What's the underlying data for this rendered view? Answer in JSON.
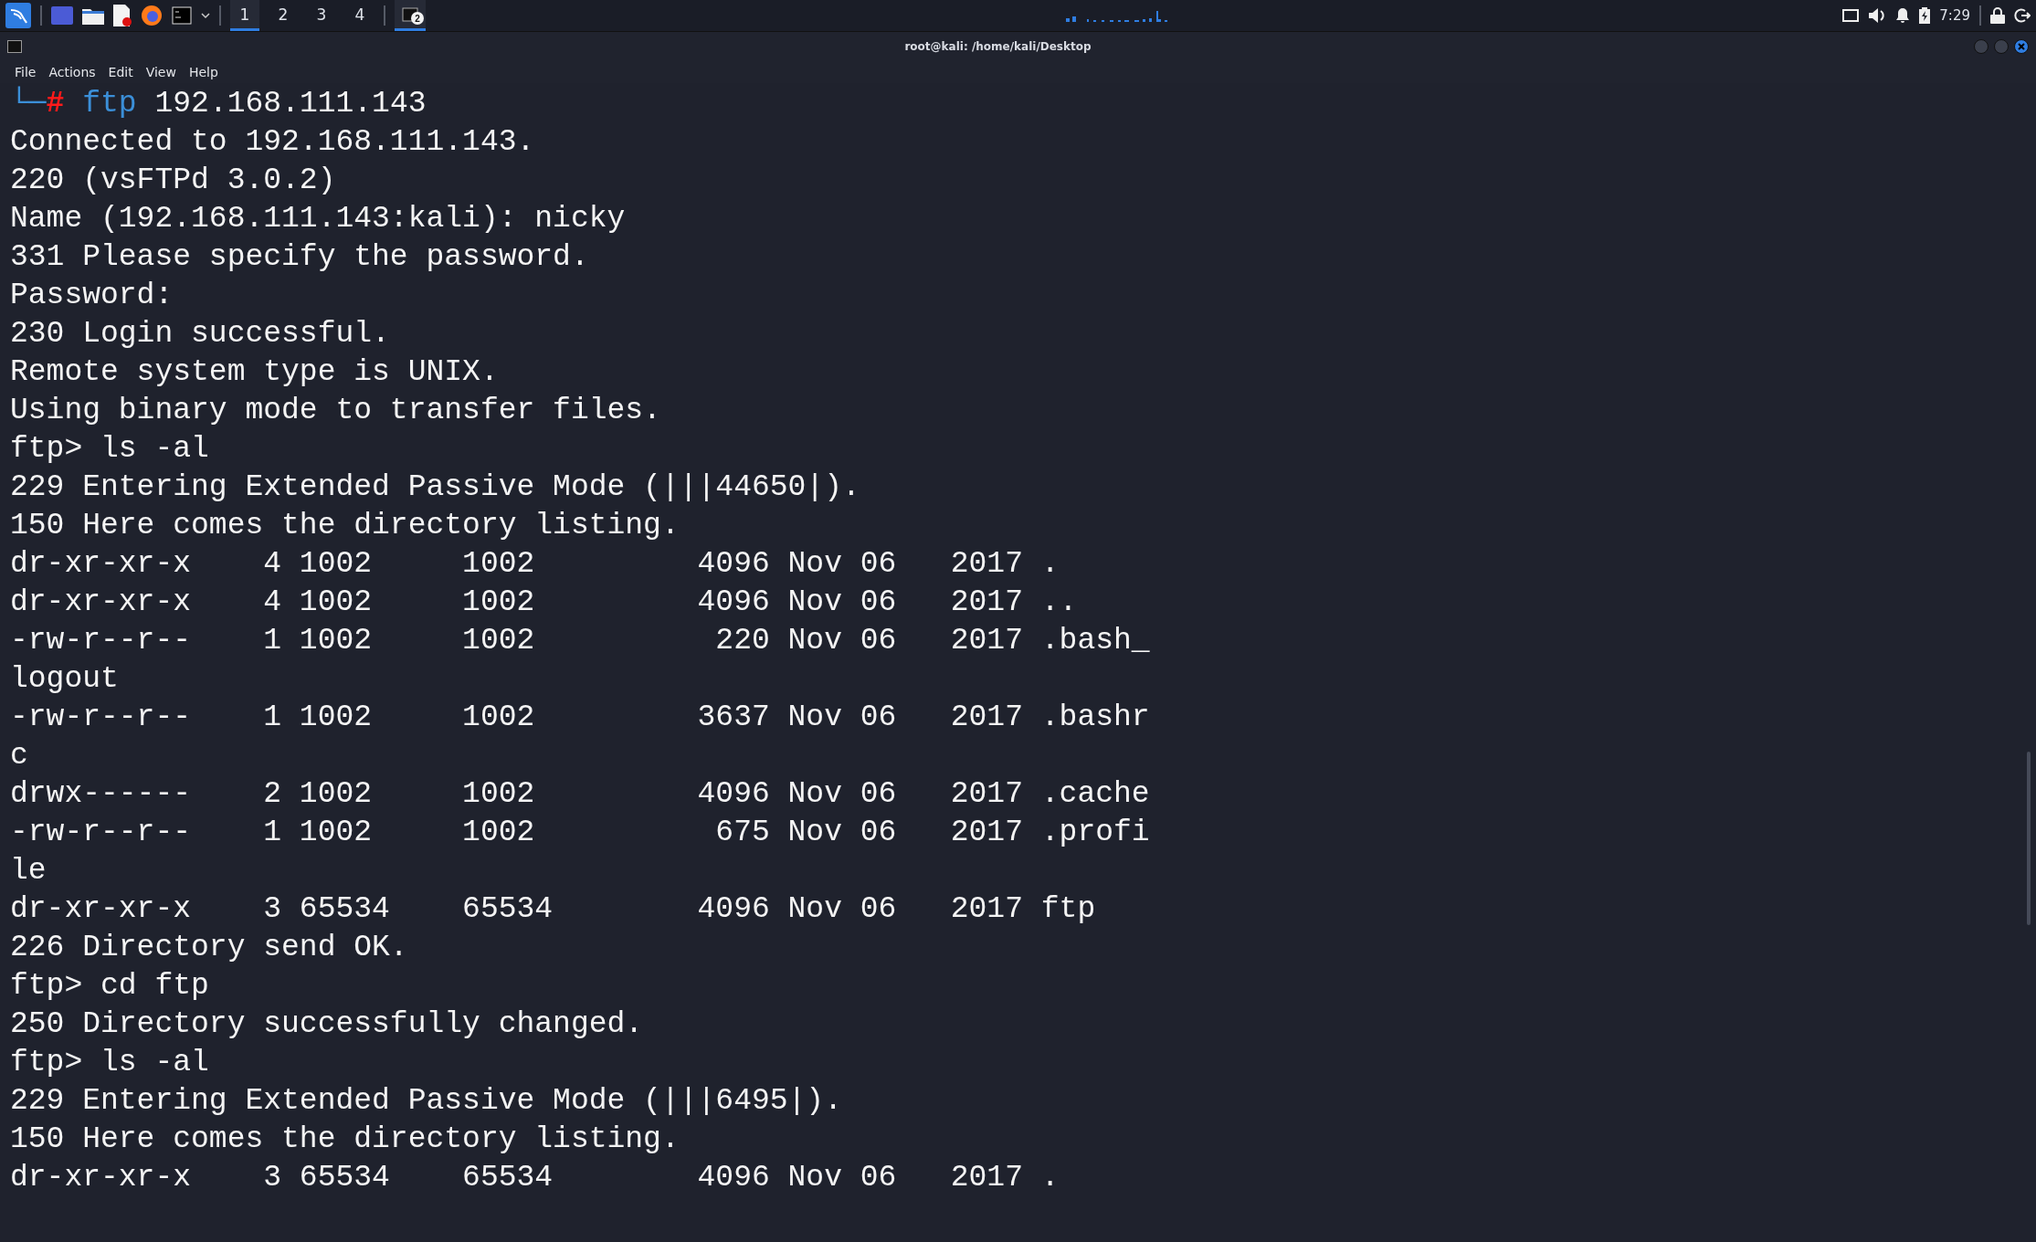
{
  "taskbar": {
    "workspaces": [
      {
        "label": "1",
        "selected": true
      },
      {
        "label": "2",
        "selected": false
      },
      {
        "label": "3",
        "selected": false
      },
      {
        "label": "4",
        "selected": false
      }
    ],
    "task": {
      "badge": "2",
      "selected": true
    },
    "clock": "7:29"
  },
  "window": {
    "title": "root@kali: /home/kali/Desktop"
  },
  "menu": [
    "File",
    "Actions",
    "Edit",
    "View",
    "Help"
  ],
  "terminal": {
    "prompt": {
      "corner": "└─",
      "symbol": "#",
      "command": "ftp",
      "args": "192.168.111.143"
    },
    "lines": [
      "Connected to 192.168.111.143.",
      "220 (vsFTPd 3.0.2)",
      "Name (192.168.111.143:kali): nicky",
      "331 Please specify the password.",
      "Password:",
      "230 Login successful.",
      "Remote system type is UNIX.",
      "Using binary mode to transfer files.",
      "ftp> ls -al",
      "229 Entering Extended Passive Mode (|||44650|).",
      "150 Here comes the directory listing.",
      "dr-xr-xr-x    4 1002     1002         4096 Nov 06   2017 .",
      "dr-xr-xr-x    4 1002     1002         4096 Nov 06   2017 ..",
      "-rw-r--r--    1 1002     1002          220 Nov 06   2017 .bash_",
      "logout",
      "-rw-r--r--    1 1002     1002         3637 Nov 06   2017 .bashr",
      "c",
      "drwx------    2 1002     1002         4096 Nov 06   2017 .cache",
      "-rw-r--r--    1 1002     1002          675 Nov 06   2017 .profi",
      "le",
      "dr-xr-xr-x    3 65534    65534        4096 Nov 06   2017 ftp",
      "226 Directory send OK.",
      "ftp> cd ftp",
      "250 Directory successfully changed.",
      "ftp> ls -al",
      "229 Entering Extended Passive Mode (|||6495|).",
      "150 Here comes the directory listing.",
      "dr-xr-xr-x    3 65534    65534        4096 Nov 06   2017 ."
    ]
  }
}
